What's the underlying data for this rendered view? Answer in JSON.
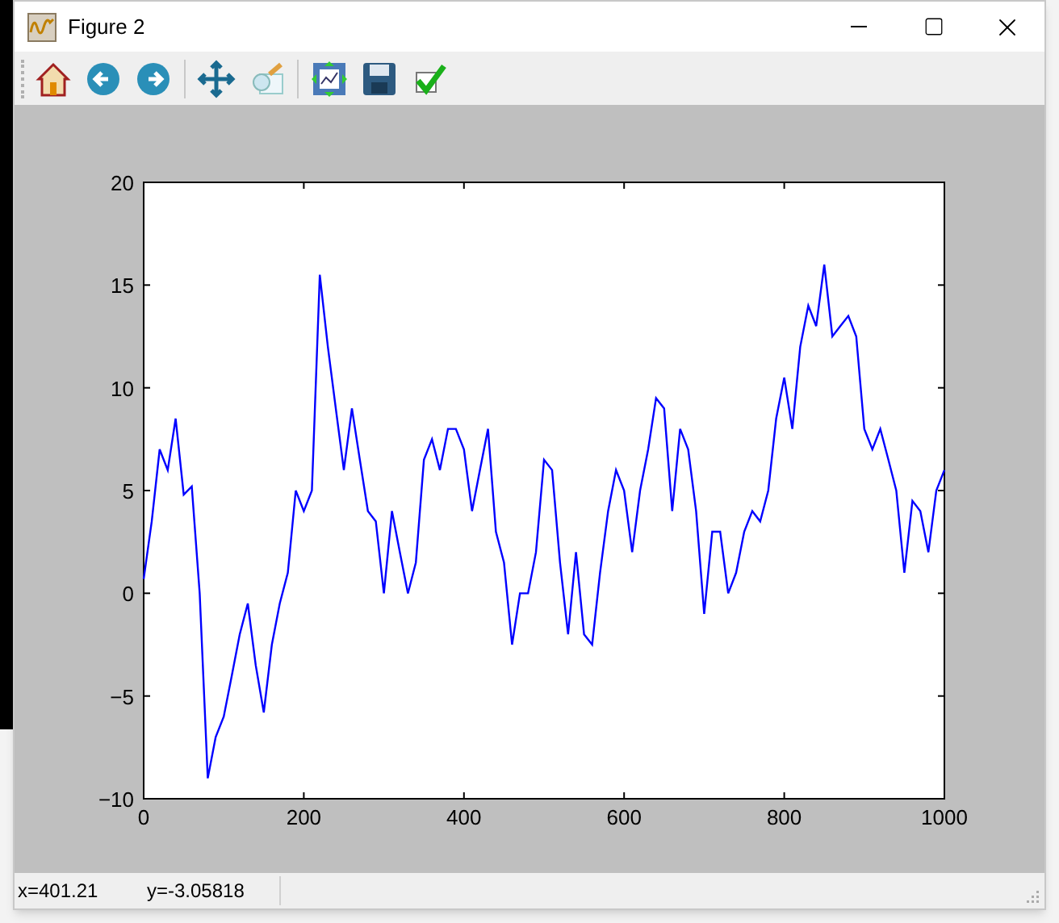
{
  "window": {
    "title": "Figure 2"
  },
  "figure": {
    "chart_data": {
      "type": "line",
      "x": [
        0,
        10,
        20,
        30,
        40,
        50,
        60,
        70,
        80,
        90,
        100,
        110,
        120,
        130,
        140,
        150,
        160,
        170,
        180,
        190,
        200,
        210,
        220,
        230,
        240,
        250,
        260,
        270,
        280,
        290,
        300,
        310,
        320,
        330,
        340,
        350,
        360,
        370,
        380,
        390,
        400,
        410,
        420,
        430,
        440,
        450,
        460,
        470,
        480,
        490,
        500,
        510,
        520,
        530,
        540,
        550,
        560,
        570,
        580,
        590,
        600,
        610,
        620,
        630,
        640,
        650,
        660,
        670,
        680,
        690,
        700,
        710,
        720,
        730,
        740,
        750,
        760,
        770,
        780,
        790,
        800,
        810,
        820,
        830,
        840,
        850,
        860,
        870,
        880,
        890,
        900,
        910,
        920,
        930,
        940,
        950,
        960,
        970,
        980,
        990,
        1000
      ],
      "series": [
        {
          "color": "#0000ff",
          "values": [
            0.7,
            3.5,
            7,
            6,
            8.5,
            4.8,
            5.2,
            0,
            -9,
            -7,
            -6,
            -4,
            -2,
            -0.5,
            -3.5,
            -5.8,
            -2.5,
            -0.5,
            1,
            5,
            4,
            5,
            15.5,
            12,
            9,
            6,
            9,
            6.5,
            4,
            3.5,
            0,
            4,
            2,
            0,
            1.5,
            6.5,
            7.5,
            6,
            8,
            8,
            7,
            4,
            6,
            8,
            3,
            1.5,
            -2.5,
            0,
            0,
            2,
            6.5,
            6,
            1.5,
            -2,
            2,
            -2,
            -2.5,
            1,
            4,
            6,
            5,
            2,
            5,
            7,
            9.5,
            9,
            4,
            8,
            7,
            4,
            -1,
            3,
            3,
            0,
            1,
            3,
            4,
            3.5,
            5,
            8.5,
            10.5,
            8,
            12,
            14,
            13,
            16,
            12.5,
            13,
            13.5,
            12.5,
            8,
            7,
            8,
            6.5,
            5,
            1,
            4.5,
            4,
            2,
            5,
            6
          ]
        }
      ],
      "xlim": [
        0,
        1000
      ],
      "ylim": [
        -10,
        20
      ],
      "xticks": [
        0,
        200,
        400,
        600,
        800,
        1000
      ],
      "yticks": [
        {
          "value": -10,
          "label": "−10"
        },
        {
          "value": -5,
          "label": "−5"
        },
        0,
        5,
        10,
        15,
        20
      ]
    }
  },
  "status_bar": {
    "x_reading": "x=401.21",
    "y_reading": "y=-3.05818"
  }
}
